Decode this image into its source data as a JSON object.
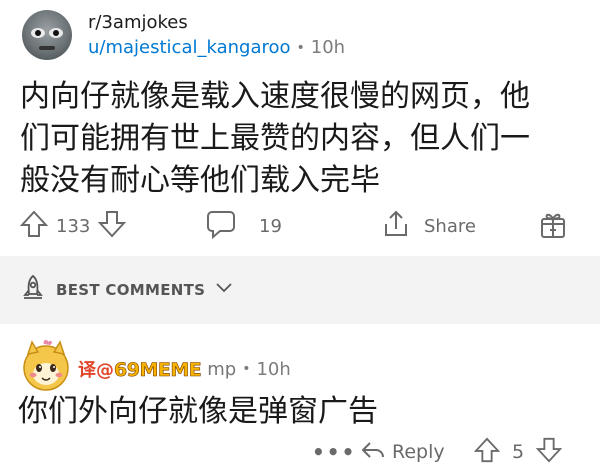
{
  "post": {
    "subreddit": "r/3amjokes",
    "username": "u/majestical_kangaroo",
    "separator": "•",
    "time": "10h",
    "body_lines": [
      "内向仔就像是载入速度很慢的网页，他",
      "们可能拥有世上最赞的内容，但人们一",
      "般没有耐心等他们载入完毕"
    ],
    "upvotes": "133",
    "comments": "19",
    "share_label": "Share"
  },
  "sort": {
    "label": "BEST COMMENTS"
  },
  "comment": {
    "watermark_prefix": "译@",
    "watermark_brand": "69MEME",
    "username_rest": "mp",
    "separator": "•",
    "time": "10h",
    "body": "你们外向仔就像是弹窗广告",
    "more": "•••",
    "reply_label": "Reply",
    "votes": "5"
  },
  "colors": {
    "link": "#0079d3",
    "meta": "#7c7c7c",
    "band": "#f3f3f3"
  }
}
